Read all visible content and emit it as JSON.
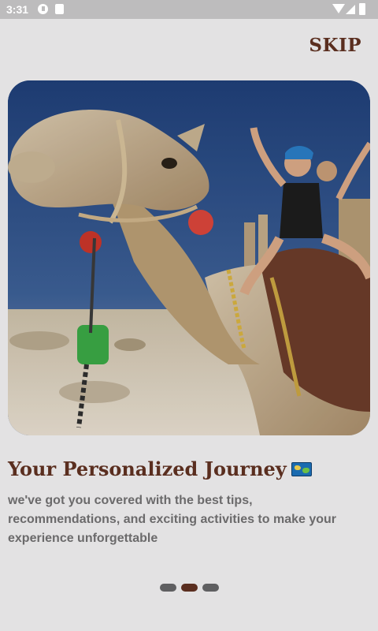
{
  "status_bar": {
    "time": "3:31"
  },
  "header": {
    "skip_label": "SKIP"
  },
  "onboarding": {
    "title": "Your Personalized Journey",
    "title_emoji": "world-map-emoji",
    "description": "we've got you covered with the best tips, recommendations, and exciting activities to make your experience unforgettable",
    "page_indicator": {
      "total": 3,
      "active_index": 1
    }
  },
  "colors": {
    "background": "#e3e2e3",
    "accent": "#5a2e1f",
    "text_muted": "#6b6a6b",
    "dot_inactive": "#5f5f61",
    "status_bar": "#bdbcbd"
  }
}
